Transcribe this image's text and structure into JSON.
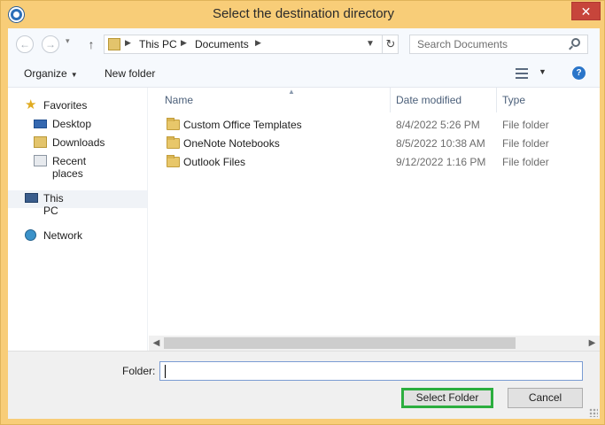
{
  "window": {
    "title": "Select the destination directory",
    "close_label": "✕"
  },
  "toolbar": {
    "back_icon": "arrow-left-icon",
    "forward_icon": "arrow-right-icon",
    "up_icon": "arrow-up-icon",
    "breadcrumb": [
      "This PC",
      "Documents"
    ],
    "search_placeholder": "Search Documents"
  },
  "command_bar": {
    "organize_label": "Organize",
    "new_folder_label": "New folder"
  },
  "sidebar": {
    "items": [
      {
        "label": "Favorites",
        "icon": "star-icon"
      },
      {
        "label": "Desktop",
        "icon": "desktop-icon"
      },
      {
        "label": "Downloads",
        "icon": "downloads-folder-icon"
      },
      {
        "label": "Recent places",
        "icon": "recent-places-icon"
      },
      {
        "label": "This PC",
        "icon": "computer-icon"
      },
      {
        "label": "Network",
        "icon": "network-icon"
      }
    ]
  },
  "file_list": {
    "columns": [
      "Name",
      "Date modified",
      "Type"
    ],
    "rows": [
      {
        "name": "Custom Office Templates",
        "date": "8/4/2022 5:26 PM",
        "type": "File folder"
      },
      {
        "name": "OneNote Notebooks",
        "date": "8/5/2022 10:38 AM",
        "type": "File folder"
      },
      {
        "name": "Outlook Files",
        "date": "9/12/2022 1:16 PM",
        "type": "File folder"
      }
    ]
  },
  "footer": {
    "folder_label": "Folder:",
    "folder_value": "",
    "select_button": "Select Folder",
    "cancel_button": "Cancel"
  },
  "colors": {
    "frame": "#f8cd78",
    "close": "#c7453b",
    "highlight": "#2cae3f"
  }
}
